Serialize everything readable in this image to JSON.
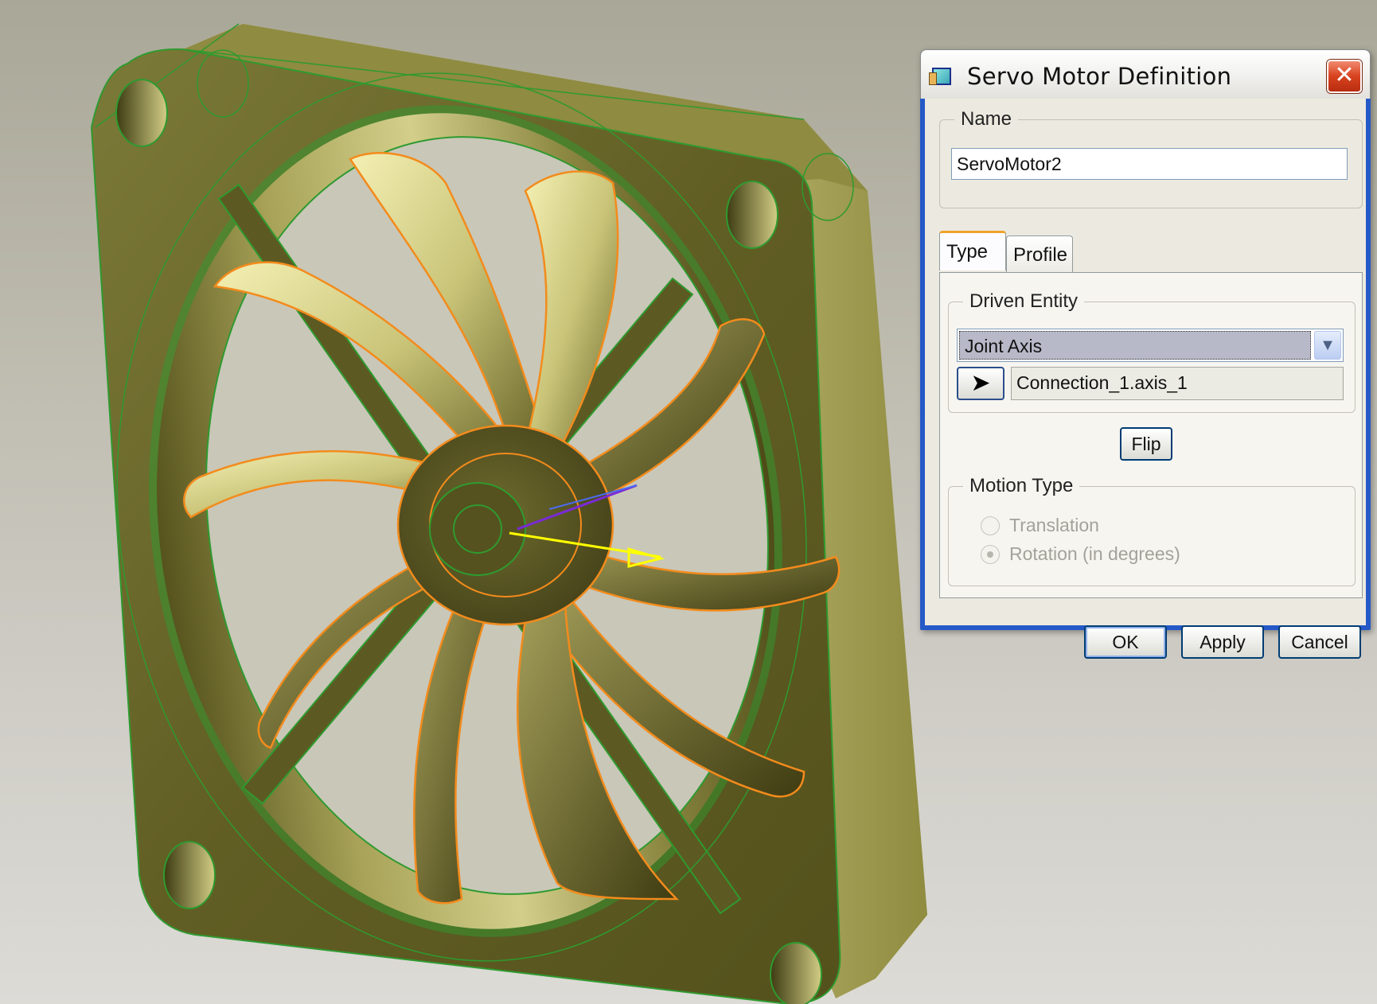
{
  "dialog": {
    "title": "Servo Motor Definition",
    "close_glyph": "✕",
    "name_legend": "Name",
    "name_value": "ServoMotor2",
    "tabs": [
      {
        "label": "Type",
        "active": true
      },
      {
        "label": "Profile",
        "active": false
      }
    ],
    "driven_entity": {
      "legend": "Driven Entity",
      "selected": "Joint Axis",
      "reference": "Connection_1.axis_1",
      "pick_icon": "pointer-arrow-icon"
    },
    "flip_label": "Flip",
    "motion_type": {
      "legend": "Motion Type",
      "options": [
        {
          "label": "Translation",
          "checked": false,
          "enabled": false
        },
        {
          "label": "Rotation (in degrees)",
          "checked": true,
          "enabled": false
        }
      ]
    },
    "buttons": {
      "ok": "OK",
      "apply": "Apply",
      "cancel": "Cancel"
    }
  },
  "colors": {
    "fan_body": "#6e6b2e",
    "fan_highlight": "#d9d48a",
    "wire_green": "#2f9a2f",
    "wire_orange": "#f38b1c"
  }
}
